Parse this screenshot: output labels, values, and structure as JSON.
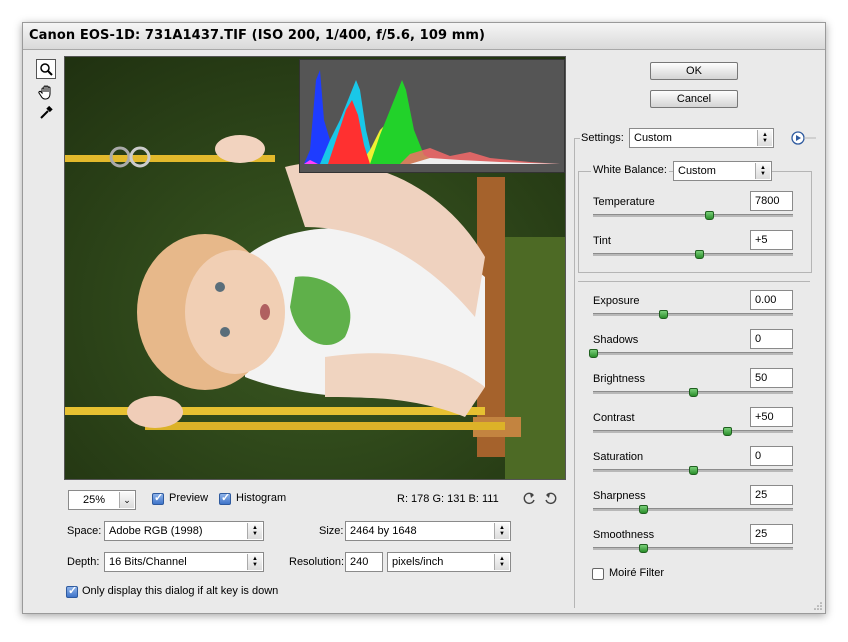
{
  "window": {
    "title": "Canon EOS-1D:  731A1437.TIF  (ISO 200, 1/400, f/5.6, 109 mm)"
  },
  "tools": [
    {
      "name": "zoom-tool",
      "icon": "magnifier-icon"
    },
    {
      "name": "hand-tool",
      "icon": "hand-icon"
    },
    {
      "name": "white-balance-tool",
      "icon": "eyedropper-icon"
    }
  ],
  "buttons": {
    "ok": "OK",
    "cancel": "Cancel"
  },
  "preview": {
    "zoom": "25%",
    "preview_label": "Preview",
    "histogram_label": "Histogram",
    "preview_checked": true,
    "histogram_checked": true,
    "rgb_readout": "R: 178  G: 131  B: 111"
  },
  "workflow": {
    "space_label": "Space:",
    "space_value": "Adobe RGB (1998)",
    "depth_label": "Depth:",
    "depth_value": "16 Bits/Channel",
    "size_label": "Size:",
    "size_value": "2464 by 1648",
    "resolution_label": "Resolution:",
    "resolution_value": "240",
    "resolution_unit": "pixels/inch",
    "alt_key_label": "Only display this dialog if alt key is down"
  },
  "settings": {
    "label": "Settings:",
    "value": "Custom",
    "white_balance_label": "White Balance:",
    "white_balance_value": "Custom",
    "wb_sliders": [
      {
        "label": "Temperature",
        "value": "7800",
        "pos": 0.58
      },
      {
        "label": "Tint",
        "value": "+5",
        "pos": 0.53
      }
    ],
    "sliders": [
      {
        "label": "Exposure",
        "value": "0.00",
        "pos": 0.35
      },
      {
        "label": "Shadows",
        "value": "0",
        "pos": 0.0
      },
      {
        "label": "Brightness",
        "value": "50",
        "pos": 0.5
      },
      {
        "label": "Contrast",
        "value": "+50",
        "pos": 0.67
      },
      {
        "label": "Saturation",
        "value": "0",
        "pos": 0.5
      },
      {
        "label": "Sharpness",
        "value": "25",
        "pos": 0.25
      },
      {
        "label": "Smoothness",
        "value": "25",
        "pos": 0.25
      }
    ],
    "moire_label": "Moiré Filter",
    "moire_checked": false
  },
  "colors": {
    "accent": "#3f74c9",
    "thumb": "#2a8e2a",
    "panel": "#eaeaea"
  }
}
